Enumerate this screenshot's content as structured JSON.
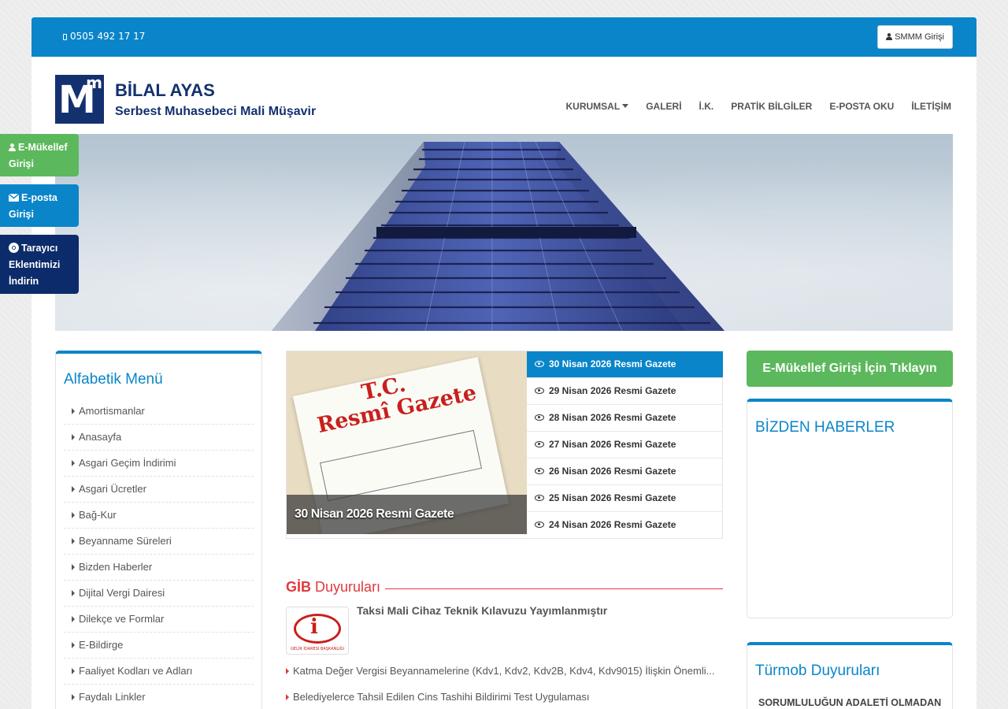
{
  "topbar": {
    "phone": "0505 492 17 17",
    "smmm_label": "SMMM Girişi"
  },
  "brand": {
    "name": "BİLAL AYAS",
    "subtitle": "Serbest Muhasebeci Mali Müşavir",
    "logo_letter": "M",
    "logo_super": "m"
  },
  "nav": {
    "items": [
      "KURUMSAL",
      "GALERİ",
      "İ.K.",
      "PRATİK BİLGİLER",
      "E-POSTA OKU",
      "İLETİŞİM"
    ]
  },
  "side_tabs": {
    "emukellef": "E-Mükellef Girişi",
    "eposta": "E-posta Girişi",
    "tarayici": "Tarayıcı Eklentimizi İndirin"
  },
  "alphabetic_menu": {
    "title": "Alfabetik Menü",
    "items": [
      "Amortismanlar",
      "Anasayfa",
      "Asgari Geçim İndirimi",
      "Asgari Ücretler",
      "Bağ-Kur",
      "Beyanname Süreleri",
      "Bizden Haberler",
      "Dijital Vergi Dairesi",
      "Dilekçe ve Formlar",
      "E-Bildirge",
      "Faaliyet Kodları ve Adları",
      "Faydalı Linkler"
    ]
  },
  "gazete": {
    "caption": "30 Nisan 2026 Resmi Gazete",
    "image_title_1": "T.C.",
    "image_title_2": "Resmî Gazete",
    "items": [
      "30 Nisan 2026 Resmi Gazete",
      "29 Nisan 2026 Resmi Gazete",
      "28 Nisan 2026 Resmi Gazete",
      "27 Nisan 2026 Resmi Gazete",
      "26 Nisan 2026 Resmi Gazete",
      "25 Nisan 2026 Resmi Gazete",
      "24 Nisan 2026 Resmi Gazete"
    ]
  },
  "gib": {
    "title_bold": "GİB",
    "title_rest": "Duyuruları",
    "headline": "Taksi Mali Cihaz Teknik Kılavuzu Yayımlanmıştır",
    "logo_text": "GELİR İDARESİ BAŞKANLIĞI",
    "items": [
      "Katma Değer Vergisi Beyannamelerine (Kdv1, Kdv2, Kdv2B, Kdv4, Kdv9015) İlişkin Önemli...",
      "Belediyelerce Tahsil Edilen Cins Tashihi Bildirimi Test Uygulaması"
    ]
  },
  "right": {
    "emukellef_btn": "E-Mükellef Girişi İçin Tıklayın",
    "bizden_title": "BİZDEN HABERLER",
    "turmob_title": "Türmob Duyuruları",
    "turmob_first": "SORUMLULUĞUN ADALETİ OLMADAN"
  },
  "colors": {
    "primary": "#0a85c9",
    "navy": "#13316f",
    "green": "#5cb85c",
    "red": "#e0393e"
  }
}
